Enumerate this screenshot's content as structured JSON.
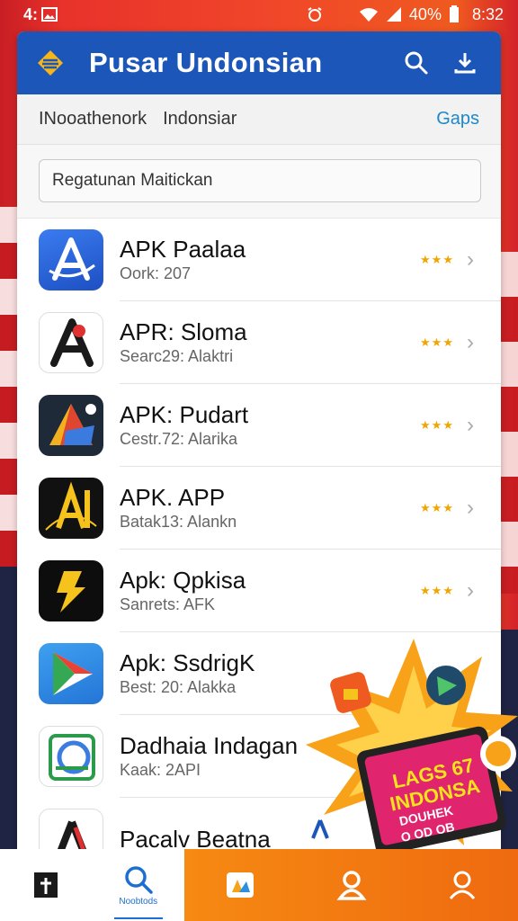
{
  "status_bar": {
    "time_left": "4:",
    "battery_percent": "40%",
    "clock": "8:32",
    "icons": [
      "gallery-icon",
      "alarm-icon",
      "wifi-icon",
      "signal-icon",
      "battery-icon"
    ]
  },
  "app_bar": {
    "title": "Pusar Undonsian",
    "icons": [
      "logo-icon",
      "search-icon",
      "download-icon"
    ]
  },
  "tabs": [
    {
      "label": "INooathenork"
    },
    {
      "label": "Indonsiar"
    },
    {
      "label": "Gaps"
    }
  ],
  "search": {
    "value": "Regatunan Maitickan"
  },
  "apps": [
    {
      "name": "APK Paalaa",
      "sub": "Oork: 207",
      "rating_glyph": "★★★"
    },
    {
      "name": "APR: Sloma",
      "sub": "Searc29: Alaktri",
      "rating_glyph": "★★★"
    },
    {
      "name": "APK: Pudart",
      "sub": "Cestr.72: Alarika",
      "rating_glyph": "★★★"
    },
    {
      "name": "APK. APP",
      "sub": "Batak13: Alankn",
      "rating_glyph": "★★★"
    },
    {
      "name": "Apk: Qpkisa",
      "sub": "Sanrets: AFK",
      "rating_glyph": "★★★"
    },
    {
      "name": "Apk: SsdrigK",
      "sub": "Best: 20: Alakka",
      "rating_glyph": ""
    },
    {
      "name": "Dadhaia Indagan",
      "sub": "Kaak: 2API",
      "rating_glyph": ""
    },
    {
      "name": "Pacalv Beatna",
      "sub": "",
      "rating_glyph": ""
    }
  ],
  "promo": {
    "line1": "LAGS 67",
    "line2": "INDONSA",
    "line3": "DOUHEK",
    "line4": "O OD OB"
  },
  "bottom_nav": [
    {
      "icon": "bookmark-icon",
      "label": ""
    },
    {
      "icon": "search-icon",
      "label": "Noobtods"
    },
    {
      "icon": "photo-icon",
      "label": ""
    },
    {
      "icon": "profile-icon",
      "label": ""
    },
    {
      "icon": "account-icon",
      "label": ""
    }
  ],
  "colors": {
    "brand_blue": "#1b56b8",
    "accent_link": "#1e88c8",
    "background_red": "#e8322b",
    "nav_orange": "#f68a12",
    "star": "#f2a400"
  }
}
